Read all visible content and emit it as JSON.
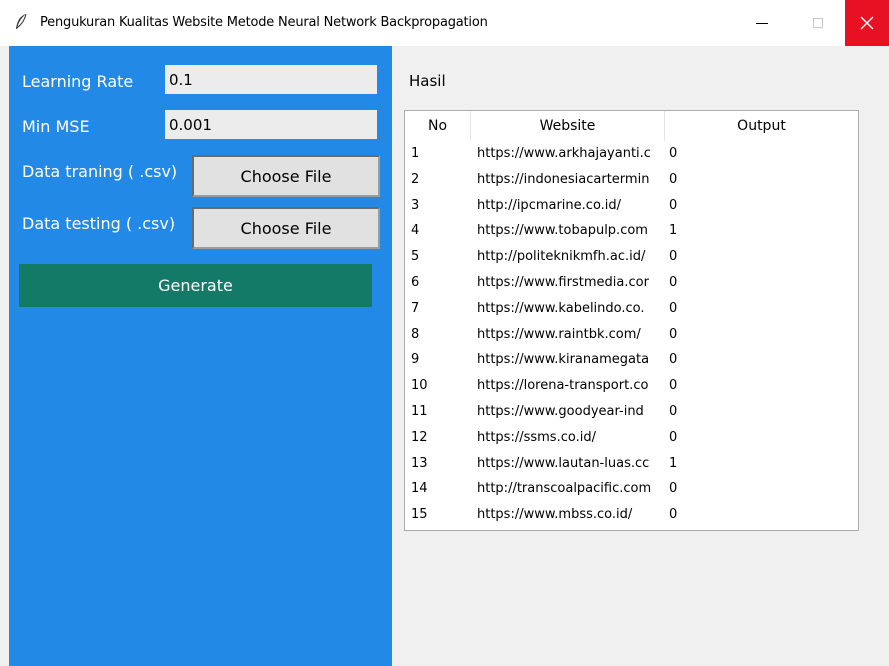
{
  "window": {
    "title": "Pengukuran Kualitas Website Metode Neural Network Backpropagation",
    "icon": "feather-icon",
    "close_color": "#e81123"
  },
  "form": {
    "learning_rate_label": "Learning Rate",
    "learning_rate_value": "0.1",
    "min_mse_label": "Min MSE",
    "min_mse_value": "0.001",
    "training_label": "Data traning ( .csv)",
    "training_button": "Choose File",
    "testing_label": "Data testing ( .csv)",
    "testing_button": "Choose File",
    "generate_label": "Generate",
    "panel_color": "#2389e6",
    "generate_color": "#137a67"
  },
  "result": {
    "label": "Hasil",
    "columns": [
      "No",
      "Website",
      "Output"
    ],
    "rows": [
      {
        "no": "1",
        "website": "https://www.arkhajayanti.c",
        "output": "0"
      },
      {
        "no": "2",
        "website": "https://indonesiacartermin",
        "output": "0"
      },
      {
        "no": "3",
        "website": "http://ipcmarine.co.id/",
        "output": "0"
      },
      {
        "no": "4",
        "website": "https://www.tobapulp.com",
        "output": "1"
      },
      {
        "no": "5",
        "website": "http://politeknikmfh.ac.id/",
        "output": "0"
      },
      {
        "no": "6",
        "website": "https://www.firstmedia.cor",
        "output": "0"
      },
      {
        "no": "7",
        "website": "https://www.kabelindo.co.",
        "output": "0"
      },
      {
        "no": "8",
        "website": "https://www.raintbk.com/",
        "output": "0"
      },
      {
        "no": "9",
        "website": "https://www.kiranamegata",
        "output": "0"
      },
      {
        "no": "10",
        "website": "https://lorena-transport.co",
        "output": "0"
      },
      {
        "no": "11",
        "website": "https://www.goodyear-ind",
        "output": "0"
      },
      {
        "no": "12",
        "website": "https://ssms.co.id/",
        "output": "0"
      },
      {
        "no": "13",
        "website": "https://www.lautan-luas.cc",
        "output": "1"
      },
      {
        "no": "14",
        "website": "http://transcoalpacific.com",
        "output": "0"
      },
      {
        "no": "15",
        "website": "https://www.mbss.co.id/",
        "output": "0"
      }
    ]
  }
}
